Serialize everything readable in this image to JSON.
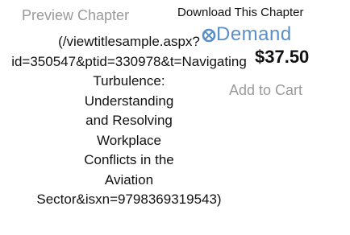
{
  "preview": {
    "label": "Preview Chapter"
  },
  "url_lines": [
    "(/viewtitlesample.aspx?",
    "id=350547&ptid=330978&t=Navigating",
    "Turbulence:",
    "Understanding",
    "and Resolving",
    "Workplace",
    "Conflicts in the",
    "Aviation",
    "Sector&isxn=9798369319543)"
  ],
  "download": {
    "label": "Download This Chapter"
  },
  "ondemand": {
    "logo_text": "Demand",
    "icon": "ondemand-logo-icon",
    "color": "#5b8fc7"
  },
  "price": {
    "value": "$37.50"
  },
  "cart": {
    "label": "Add to Cart"
  }
}
